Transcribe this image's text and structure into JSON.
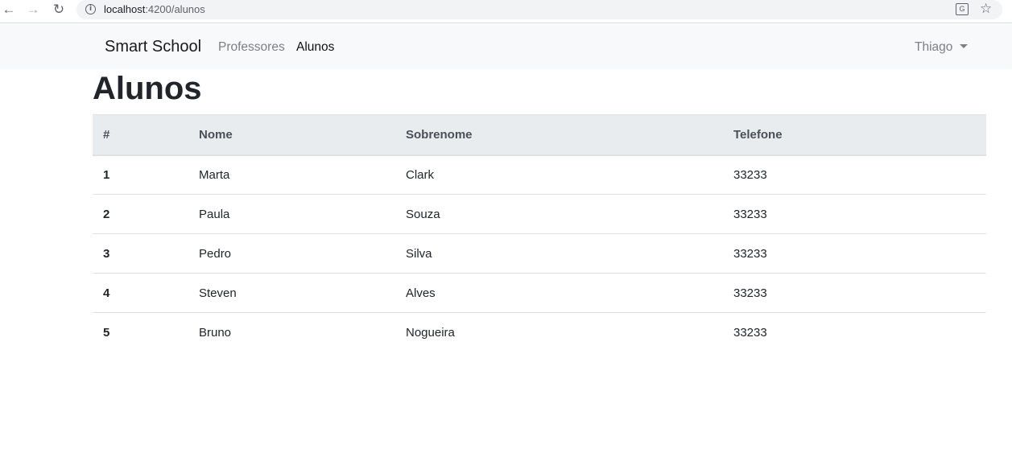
{
  "browser": {
    "url_host": "localhost",
    "url_path": ":4200/alunos"
  },
  "navbar": {
    "brand": "Smart School",
    "links": [
      {
        "label": "Professores",
        "active": false
      },
      {
        "label": "Alunos",
        "active": true
      }
    ],
    "user": "Thiago"
  },
  "page": {
    "title": "Alunos"
  },
  "table": {
    "headers": [
      "#",
      "Nome",
      "Sobrenome",
      "Telefone"
    ],
    "rows": [
      {
        "id": "1",
        "nome": "Marta",
        "sobrenome": "Clark",
        "telefone": "33233"
      },
      {
        "id": "2",
        "nome": "Paula",
        "sobrenome": "Souza",
        "telefone": "33233"
      },
      {
        "id": "3",
        "nome": "Pedro",
        "sobrenome": "Silva",
        "telefone": "33233"
      },
      {
        "id": "4",
        "nome": "Steven",
        "sobrenome": "Alves",
        "telefone": "33233"
      },
      {
        "id": "5",
        "nome": "Bruno",
        "sobrenome": "Nogueira",
        "telefone": "33233"
      }
    ]
  },
  "colors": {
    "navbar_bg": "#f8f9fa",
    "table_head_bg": "#e9ecef",
    "muted_link": "#7d7f82"
  }
}
